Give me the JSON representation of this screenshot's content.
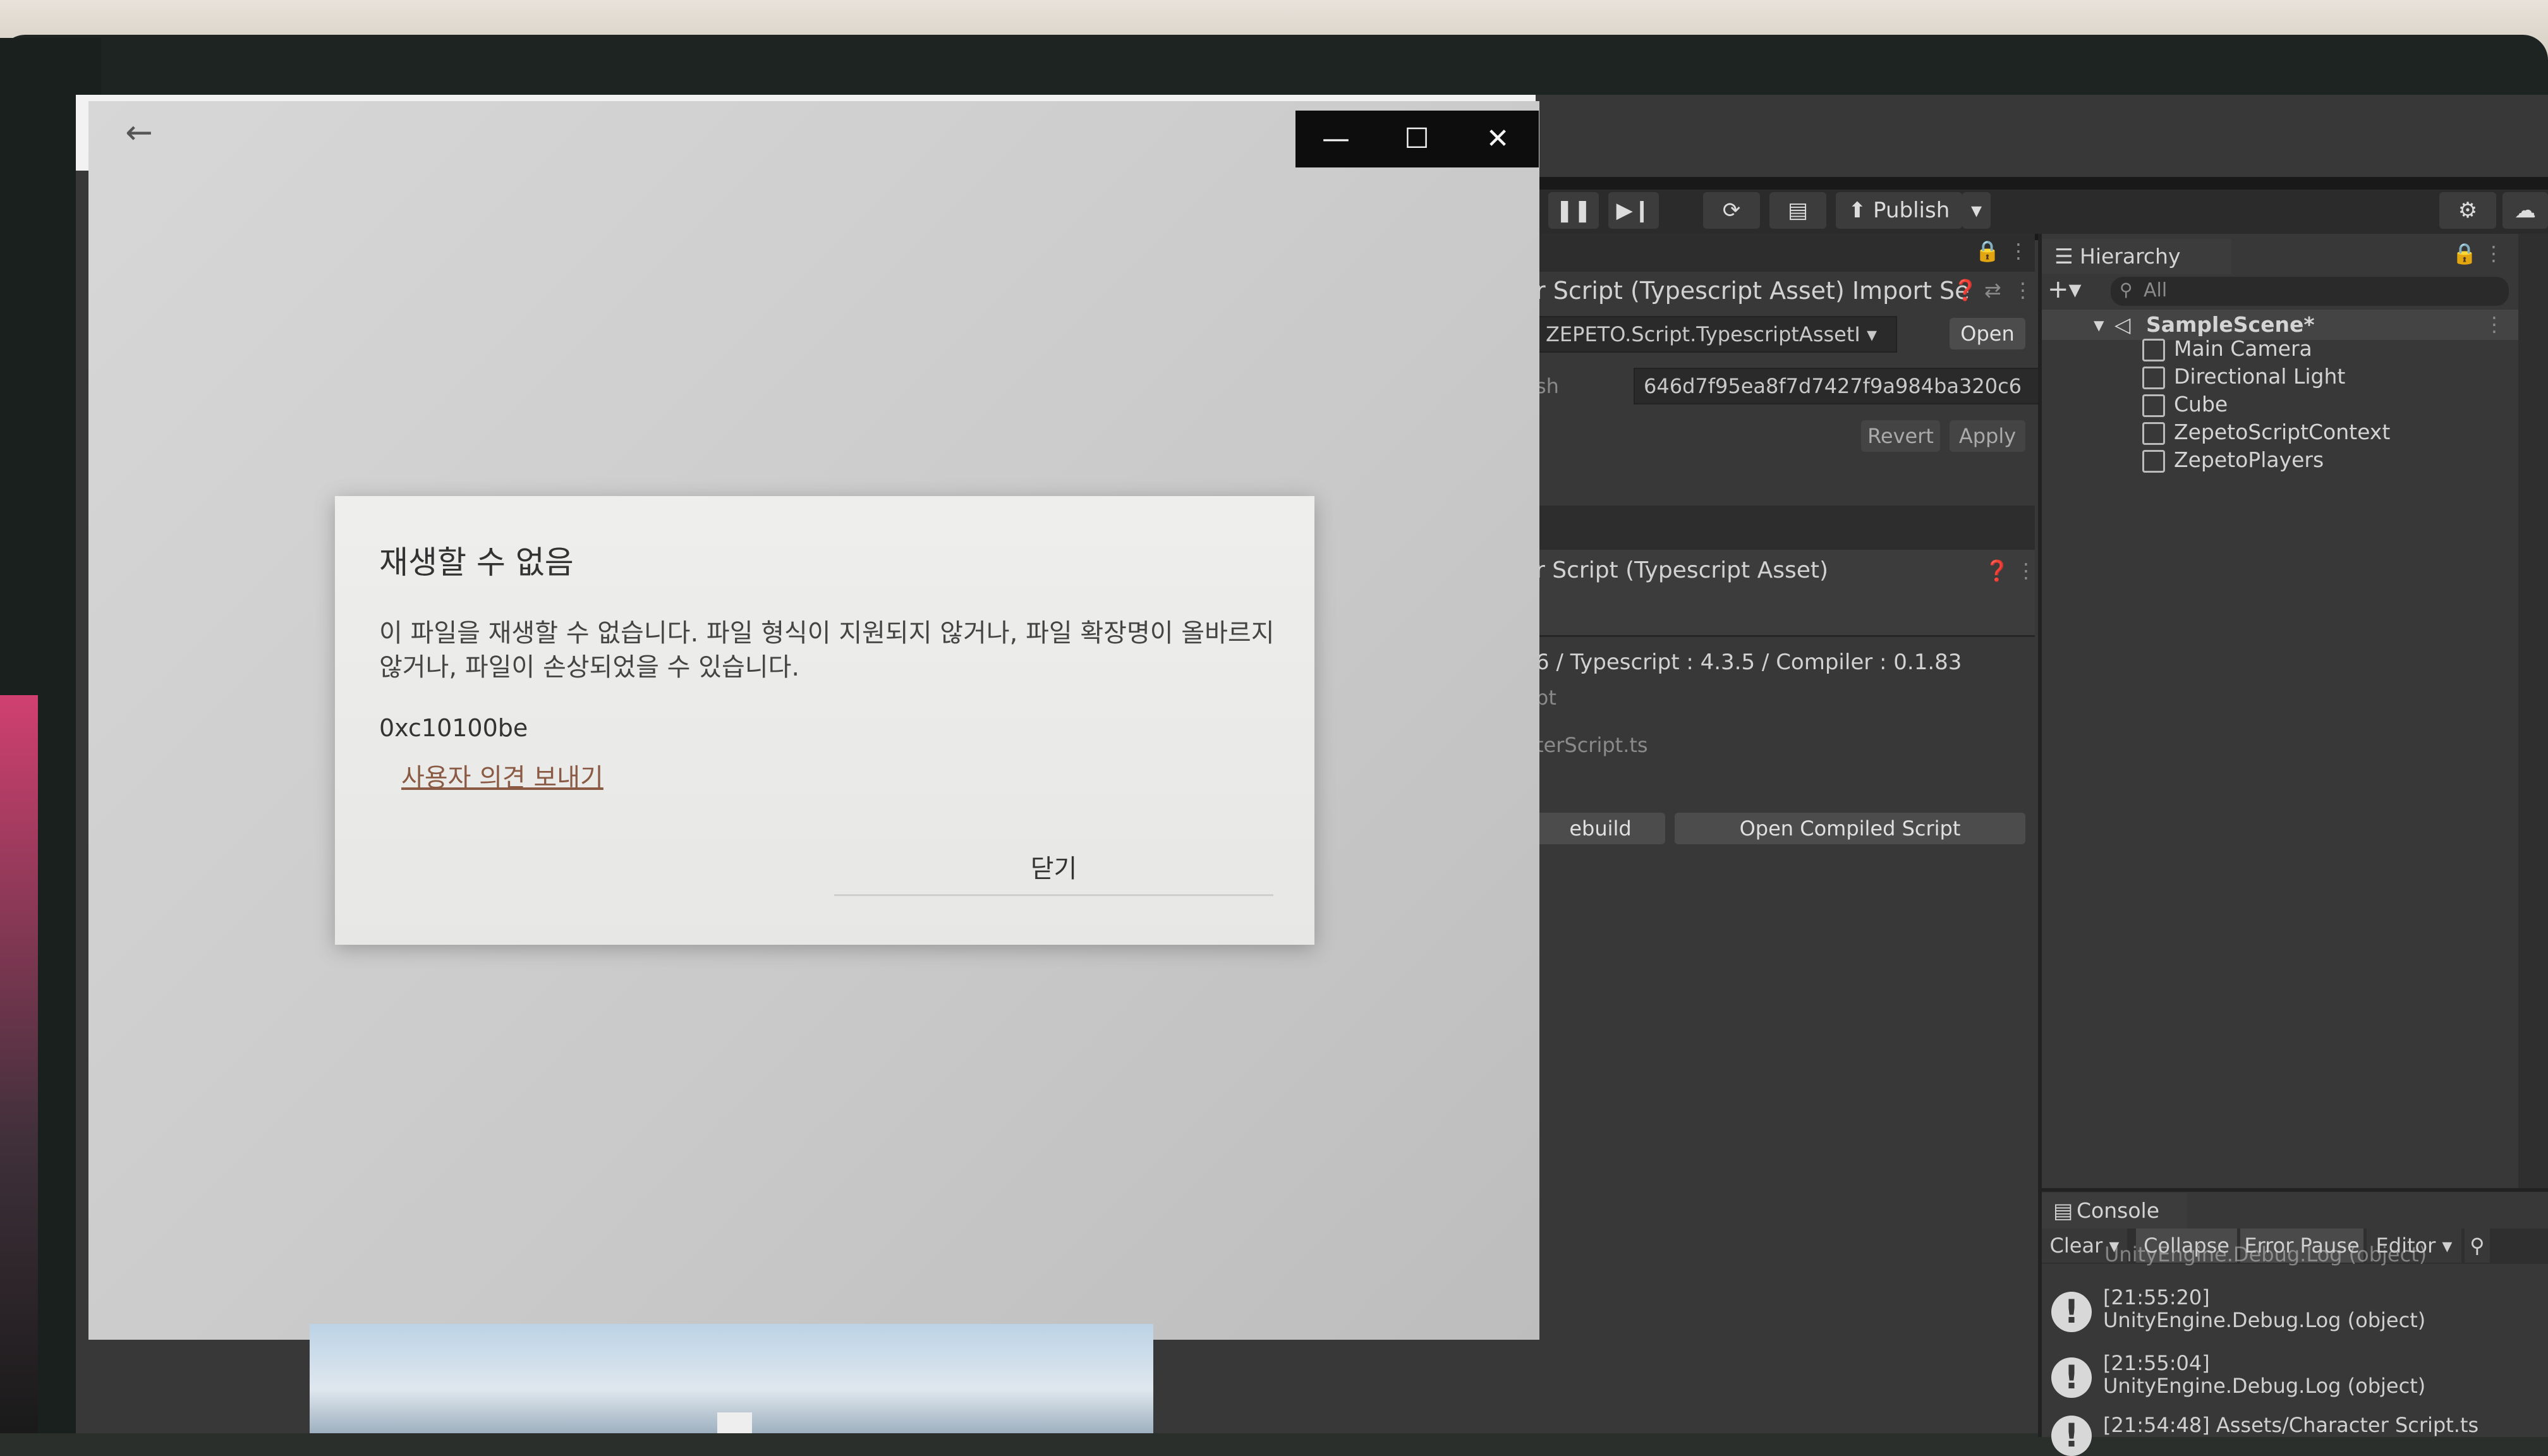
{
  "dialog": {
    "title": "재생할 수 없음",
    "message": "이 파일을 재생할 수 없습니다. 파일 형식이 지원되지 않거나, 파일 확장명이 올바르지 않거나, 파일이 손상되었을 수 있습니다.",
    "error_code": "0xc10100be",
    "feedback_link": "사용자 의견 보내기",
    "close_label": "닫기"
  },
  "toolbar": {
    "publish_label": "Publish"
  },
  "inspector": {
    "header_title": "r Script (Typescript Asset) Import Se",
    "type_field": "ZEPETO.Script.TypescriptAssetI",
    "open_label": "Open",
    "hash_label": "sh",
    "hash_value": "646d7f95ea8f7d7427f9a984ba320c6",
    "revert_label": "Revert",
    "apply_label": "Apply",
    "section_title": "r Script (Typescript Asset)",
    "version_info": "6 / Typescript : 4.3.5 / Compiler : 0.1.83",
    "script_label": "pt",
    "script_file": "terScript.ts",
    "rebuild_label": "ebuild",
    "open_compiled_label": "Open Compiled Script"
  },
  "hierarchy": {
    "tab_label": "Hierarchy",
    "search_placeholder": "All",
    "scene": "SampleScene*",
    "items": [
      "Main Camera",
      "Directional Light",
      "Cube",
      "ZepetoScriptContext",
      "ZepetoPlayers"
    ]
  },
  "console": {
    "tab_label": "Console",
    "clear_label": "Clear",
    "collapse_label": "Collapse",
    "error_pause_label": "Error Pause",
    "editor_label": "Editor",
    "partial_top": "UnityEngine.Debug.Log (object)",
    "logs": [
      {
        "time": "[21:55:20]",
        "text": "UnityEngine.Debug.Log (object)"
      },
      {
        "time": "[21:55:04]",
        "text": "UnityEngine.Debug.Log (object)"
      }
    ],
    "partial_bottom": "[21:54:48] Assets/Character Script.ts"
  }
}
